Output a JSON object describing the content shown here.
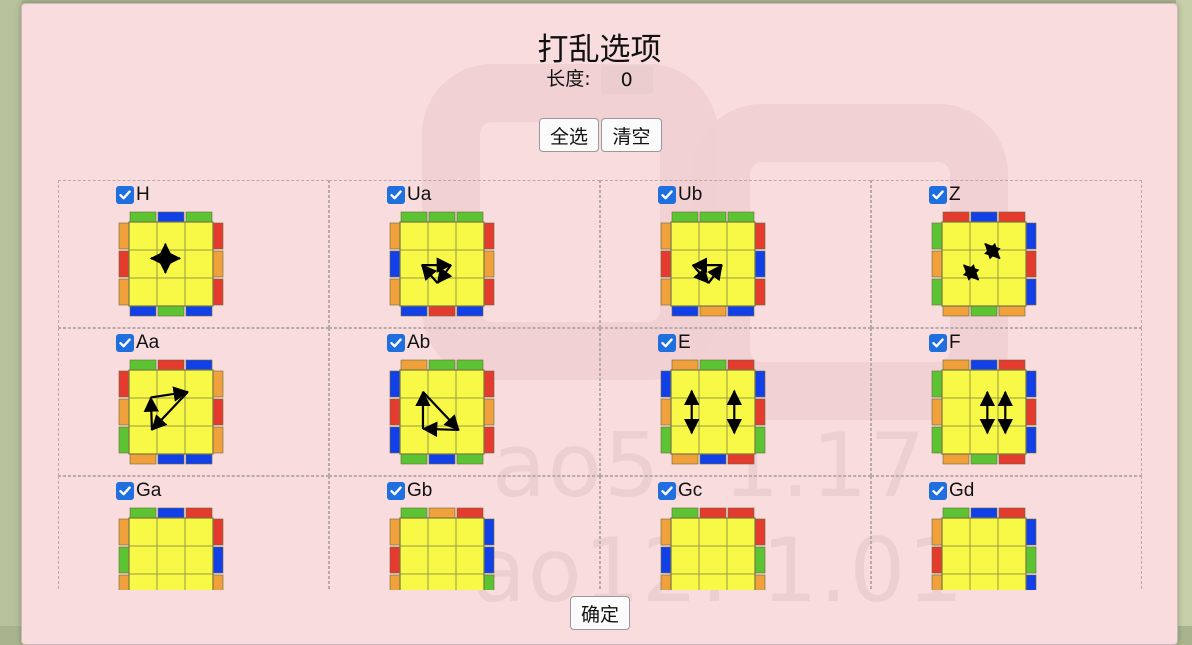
{
  "dialog": {
    "title": "打乱选项",
    "length_label": "长度:",
    "length_value": "0",
    "select_all_label": "全选",
    "clear_label": "清空",
    "confirm_label": "确定"
  },
  "watermark": {
    "line1": "ao5: 1.17",
    "line2": "ao12: 1.01"
  },
  "colors": {
    "yellow": "#f8f846",
    "red": "#e53a2e",
    "blue": "#1240e8",
    "green": "#5cc433",
    "orange": "#f0a13b",
    "grid": "#9a9a4a",
    "checkbox": "#1f6fde"
  },
  "cases": [
    {
      "label": "H",
      "checked": true,
      "top": [
        "green",
        "blue",
        "green"
      ],
      "bottom": [
        "blue",
        "green",
        "blue"
      ],
      "left": [
        "orange",
        "red",
        "orange"
      ],
      "right": [
        "red",
        "orange",
        "red"
      ],
      "arrows": [
        [
          [
            1,
            0.35
          ],
          [
            1,
            1.65
          ],
          "both"
        ],
        [
          [
            0.35,
            1
          ],
          [
            1.65,
            1
          ],
          "both"
        ]
      ]
    },
    {
      "label": "Ua",
      "checked": true,
      "top": [
        "green",
        "green",
        "green"
      ],
      "bottom": [
        "blue",
        "red",
        "blue"
      ],
      "left": [
        "orange",
        "blue",
        "orange"
      ],
      "right": [
        "red",
        "orange",
        "red"
      ],
      "arrows": [
        [
          [
            0.35,
            1.3
          ],
          [
            1.65,
            1.3
          ],
          "end"
        ],
        [
          [
            1.65,
            1.3
          ],
          [
            1.05,
            2.1
          ],
          "end"
        ],
        [
          [
            1.05,
            2.1
          ],
          [
            0.35,
            1.3
          ],
          "end"
        ]
      ]
    },
    {
      "label": "Ub",
      "checked": true,
      "top": [
        "green",
        "green",
        "green"
      ],
      "bottom": [
        "blue",
        "orange",
        "blue"
      ],
      "left": [
        "orange",
        "red",
        "orange"
      ],
      "right": [
        "red",
        "blue",
        "red"
      ],
      "arrows": [
        [
          [
            1.65,
            1.3
          ],
          [
            0.35,
            1.3
          ],
          "end"
        ],
        [
          [
            0.35,
            1.3
          ],
          [
            1.05,
            2.1
          ],
          "end"
        ],
        [
          [
            1.05,
            2.1
          ],
          [
            1.65,
            1.3
          ],
          "end"
        ]
      ]
    },
    {
      "label": "Z",
      "checked": true,
      "top": [
        "red",
        "blue",
        "red"
      ],
      "bottom": [
        "orange",
        "green",
        "orange"
      ],
      "left": [
        "green",
        "orange",
        "green"
      ],
      "right": [
        "blue",
        "red",
        "blue"
      ],
      "arrows": [
        [
          [
            1.3,
            0.35
          ],
          [
            1.95,
            1.0
          ],
          "both"
        ],
        [
          [
            0.35,
            1.3
          ],
          [
            1.0,
            1.95
          ],
          "both"
        ]
      ]
    },
    {
      "label": "Aa",
      "checked": true,
      "top": [
        "green",
        "red",
        "blue"
      ],
      "bottom": [
        "orange",
        "blue",
        "blue"
      ],
      "left": [
        "red",
        "orange",
        "green"
      ],
      "right": [
        "orange",
        "red",
        "orange"
      ],
      "arrows": [
        [
          [
            0.35,
            0.6
          ],
          [
            2.0,
            0.35
          ],
          "end"
        ],
        [
          [
            2.0,
            0.35
          ],
          [
            0.4,
            2.05
          ],
          "end"
        ],
        [
          [
            0.4,
            2.05
          ],
          [
            0.35,
            0.6
          ],
          "end"
        ]
      ]
    },
    {
      "label": "Ab",
      "checked": true,
      "top": [
        "orange",
        "green",
        "green"
      ],
      "bottom": [
        "green",
        "blue",
        "green"
      ],
      "left": [
        "blue",
        "red",
        "blue"
      ],
      "right": [
        "red",
        "orange",
        "red"
      ],
      "arrows": [
        [
          [
            0.4,
            0.35
          ],
          [
            2.0,
            2.05
          ],
          "end"
        ],
        [
          [
            2.0,
            2.05
          ],
          [
            0.4,
            2.0
          ],
          "end"
        ],
        [
          [
            0.4,
            2.0
          ],
          [
            0.4,
            0.35
          ],
          "end"
        ]
      ]
    },
    {
      "label": "E",
      "checked": true,
      "top": [
        "orange",
        "green",
        "red"
      ],
      "bottom": [
        "orange",
        "blue",
        "red"
      ],
      "left": [
        "blue",
        "orange",
        "green"
      ],
      "right": [
        "blue",
        "red",
        "green"
      ],
      "arrows": [
        [
          [
            0.3,
            0.3
          ],
          [
            0.3,
            2.2
          ],
          "both"
        ],
        [
          [
            2.2,
            0.3
          ],
          [
            2.2,
            2.2
          ],
          "both"
        ]
      ]
    },
    {
      "label": "F",
      "checked": true,
      "top": [
        "orange",
        "blue",
        "red"
      ],
      "bottom": [
        "orange",
        "green",
        "red"
      ],
      "left": [
        "green",
        "orange",
        "green"
      ],
      "right": [
        "blue",
        "red",
        "blue"
      ],
      "arrows": [
        [
          [
            1.4,
            0.35
          ],
          [
            1.4,
            2.2
          ],
          "both"
        ],
        [
          [
            2.2,
            0.35
          ],
          [
            2.2,
            2.2
          ],
          "both"
        ]
      ]
    },
    {
      "label": "Ga",
      "checked": true,
      "top": [
        "green",
        "blue",
        "red"
      ],
      "bottom": [],
      "left": [
        "orange",
        "green",
        "orange"
      ],
      "right": [
        "red",
        "blue",
        "orange"
      ],
      "arrows": []
    },
    {
      "label": "Gb",
      "checked": true,
      "top": [
        "green",
        "orange",
        "red"
      ],
      "bottom": [],
      "left": [
        "orange",
        "red",
        "orange"
      ],
      "right": [
        "blue",
        "blue",
        "green"
      ],
      "arrows": []
    },
    {
      "label": "Gc",
      "checked": true,
      "top": [
        "green",
        "red",
        "red"
      ],
      "bottom": [],
      "left": [
        "orange",
        "blue",
        "orange"
      ],
      "right": [
        "red",
        "green",
        "orange"
      ],
      "arrows": []
    },
    {
      "label": "Gd",
      "checked": true,
      "top": [
        "green",
        "blue",
        "red"
      ],
      "bottom": [],
      "left": [
        "orange",
        "red",
        "orange"
      ],
      "right": [
        "blue",
        "green",
        "blue"
      ],
      "arrows": []
    }
  ]
}
